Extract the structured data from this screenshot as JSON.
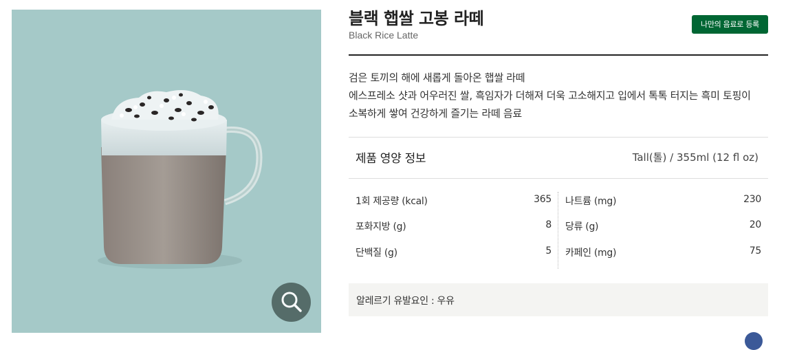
{
  "product": {
    "title": "블랙 햅쌀 고봉 라떼",
    "subtitle": "Black Rice Latte",
    "register_label": "나만의 음료로 등록",
    "description_lines": [
      "검은 토끼의 해에 새롭게 돌아온 햅쌀 라떼",
      "에스프레소 샷과 어우러진 쌀, 흑임자가 더해져 더욱 고소해지고 입에서 톡톡 터지는 흑미 토핑이",
      "소복하게 쌓여 건강하게 즐기는 라떼 음료"
    ]
  },
  "image": {
    "background_color": "#a5c9c8",
    "zoom_icon": "magnifier-icon"
  },
  "nutrition": {
    "title": "제품 영양 정보",
    "size": "Tall(톨) / 355ml (12 fl oz)",
    "rows": [
      {
        "left_label": "1회 제공량 (kcal)",
        "left_value": "365",
        "right_label": "나트륨 (mg)",
        "right_value": "230"
      },
      {
        "left_label": "포화지방 (g)",
        "left_value": "8",
        "right_label": "당류 (g)",
        "right_value": "20"
      },
      {
        "left_label": "단백질 (g)",
        "left_value": "5",
        "right_label": "카페인 (mg)",
        "right_value": "75"
      }
    ]
  },
  "allergy": {
    "text": "알레르기 유발요인 : 우유"
  },
  "colors": {
    "brand_green": "#006633",
    "image_bg": "#a5c9c8",
    "allergy_bg": "#f4f4f2"
  }
}
